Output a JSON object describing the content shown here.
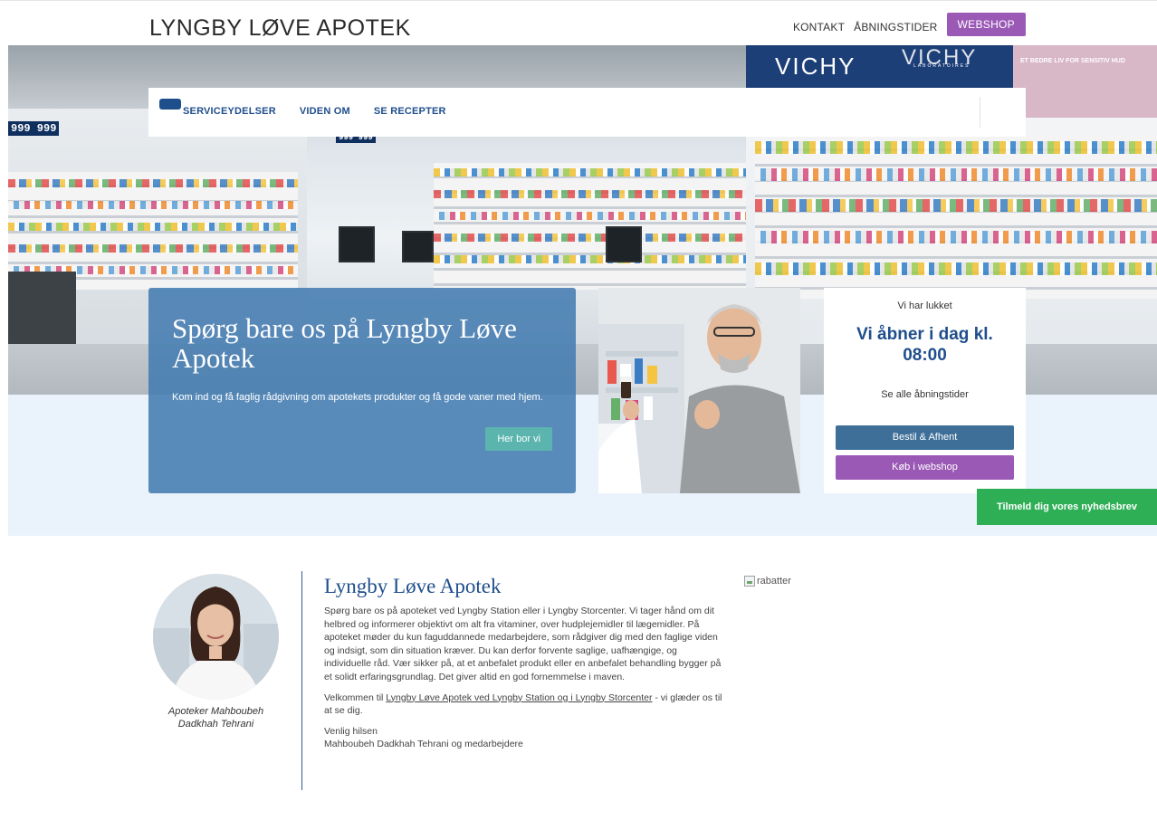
{
  "header": {
    "brand": "LYNGBY LØVE APOTEK",
    "links": [
      "KONTAKT",
      "ÅBNINGSTIDER"
    ],
    "webshop_label": "WEBSHOP"
  },
  "hero": {
    "vichy_text": "VICHY",
    "vichy_sub": "LABORATOIRES",
    "banner_text": "ET BEDRE LIV FOR SENSITIV HUD",
    "price_signs": [
      "999 999",
      "999 999"
    ]
  },
  "nav": {
    "items": [
      "SERVICEYDELSER",
      "VIDEN OM",
      "SE RECEPTER"
    ]
  },
  "infocard": {
    "title": "Spørg bare os på Lyngby Løve Apotek",
    "text": "Kom ind og få faglig rådgivning om apotekets produkter og få gode vaner med hjem.",
    "button": "Her bor vi"
  },
  "hours": {
    "status": "Vi har lukket",
    "opens": "Vi åbner i dag kl. 08:00",
    "see_all": "Se alle åbningstider",
    "order_button": "Bestil & Afhent",
    "webshop_button": "Køb i webshop"
  },
  "newsletter": {
    "label": "Tilmeld dig vores nyhedsbrev"
  },
  "pharmacist": {
    "caption": "Apoteker Mahboubeh Dadkhah Tehrani"
  },
  "article": {
    "title": "Lyngby Løve Apotek",
    "body": "Spørg bare os på apoteket ved Lyngby Station eller i Lyngby Storcenter. Vi tager hånd om dit helbred og informerer objektivt om alt fra vitaminer, over hudplejemidler til lægemidler. På apoteket møder du kun faguddannede medarbejdere, som rådgiver dig med den faglige viden og indsigt, som din situation kræver. Du kan derfor forvente saglige, uafhængige, og individuelle råd. Vær sikker på, at et anbefalet produkt eller en anbefalet behandling bygger på et solidt erfaringsgrundlag. Det giver altid en god fornemmelse i maven.",
    "welcome_prefix": "Velkommen til ",
    "welcome_link": "Lyngby Løve Apotek ved Lyngby Station og i Lyngby Storcenter",
    "welcome_suffix": " - vi glæder os til at se dig.",
    "greeting": "Venlig hilsen",
    "signature": "Mahboubeh Dadkhah Tehrani og medarbejdere"
  },
  "side": {
    "image_alt": "rabatter"
  }
}
